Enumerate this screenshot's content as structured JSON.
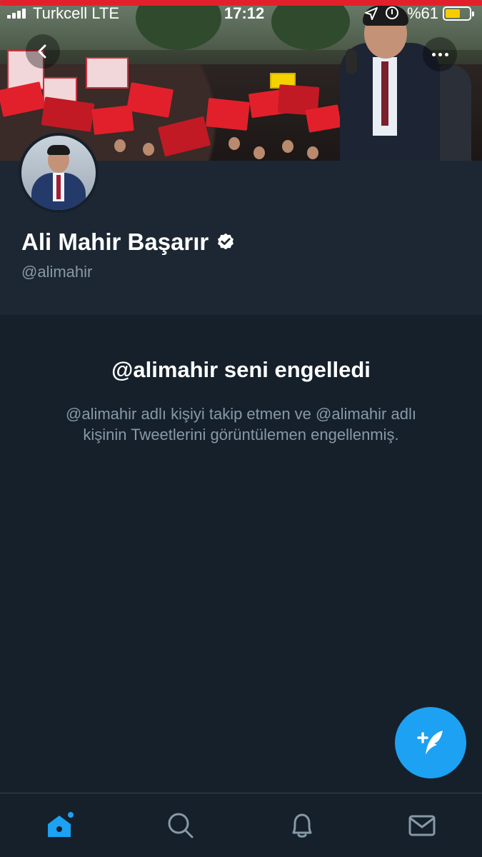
{
  "status_bar": {
    "carrier": "Turkcell  LTE",
    "time": "17:12",
    "battery_percent_label": "%61",
    "battery_level": 0.61,
    "icons": [
      "signal-icon",
      "location-icon",
      "alarm-icon",
      "battery-icon"
    ]
  },
  "header": {
    "back_icon": "chevron-left-icon",
    "more_icon": "more-dots-icon"
  },
  "profile": {
    "name": "Ali Mahir Başarır",
    "verified": true,
    "handle": "@alimahir"
  },
  "blocked": {
    "title": "@alimahir seni engelledi",
    "body": "@alimahir adlı kişiyi takip etmen ve @alimahir adlı kişinin Tweetlerini görüntülemen engellenmiş."
  },
  "fab": {
    "icon": "compose-tweet-icon"
  },
  "tab_bar": {
    "tabs": [
      {
        "name": "home",
        "icon": "home-icon",
        "active": true
      },
      {
        "name": "search",
        "icon": "search-icon",
        "active": false
      },
      {
        "name": "notifications",
        "icon": "bell-icon",
        "active": false
      },
      {
        "name": "messages",
        "icon": "mail-icon",
        "active": false
      }
    ]
  },
  "colors": {
    "background": "#15202b",
    "header_panel": "#1c2733",
    "accent": "#1da1f2",
    "secondary_text": "#8899a6"
  }
}
